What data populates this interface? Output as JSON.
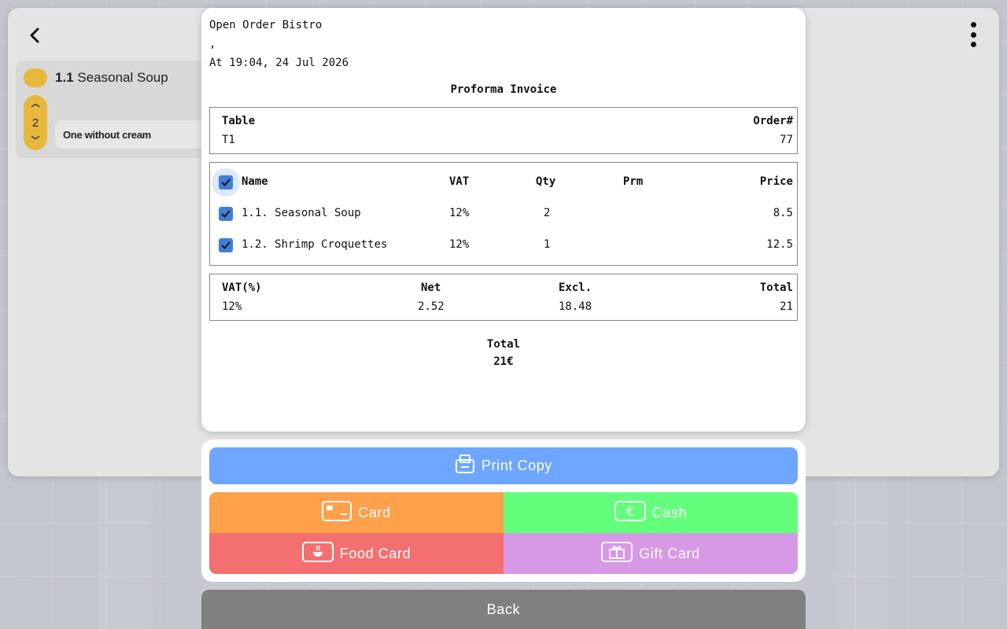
{
  "order_item": {
    "number": "1.1",
    "name": "Seasonal Soup",
    "quantity": "2",
    "note": "One without cream"
  },
  "invoice": {
    "restaurant": "Open Order Bistro",
    "address": ",",
    "datetime": "At 19:04, 24 Jul 2026",
    "doc_title": "Proforma Invoice",
    "table_label": "Table",
    "table_value": "T1",
    "order_label": "Order#",
    "order_value": "77",
    "headers": {
      "name": "Name",
      "vat": "VAT",
      "qty": "Qty",
      "prm": "Prm",
      "price": "Price"
    },
    "items": [
      {
        "name": "1.1. Seasonal Soup",
        "vat": "12%",
        "qty": "2",
        "prm": "",
        "price": "8.5"
      },
      {
        "name": "1.2. Shrimp Croquettes",
        "vat": "12%",
        "qty": "1",
        "prm": "",
        "price": "12.5"
      }
    ],
    "vat_headers": {
      "vat": "VAT(%)",
      "net": "Net",
      "excl": "Excl.",
      "total": "Total"
    },
    "vat_row": {
      "vat": "12%",
      "net": "2.52",
      "excl": "18.48",
      "total": "21"
    },
    "total_label": "Total",
    "total_value": "21€"
  },
  "payment": {
    "print_label": "Print Copy",
    "card_label": "Card",
    "cash_label": "Cash",
    "food_card_label": "Food Card",
    "gift_card_label": "Gift Card",
    "back_label": "Back"
  },
  "colors": {
    "print": "#6ea6ff",
    "card": "#ffa04a",
    "cash": "#63ff7c",
    "food_card": "#f47070",
    "gift_card": "#d798e6",
    "back": "#808080",
    "checkbox": "#3f7fd6",
    "item_accent": "#e8b83e"
  }
}
